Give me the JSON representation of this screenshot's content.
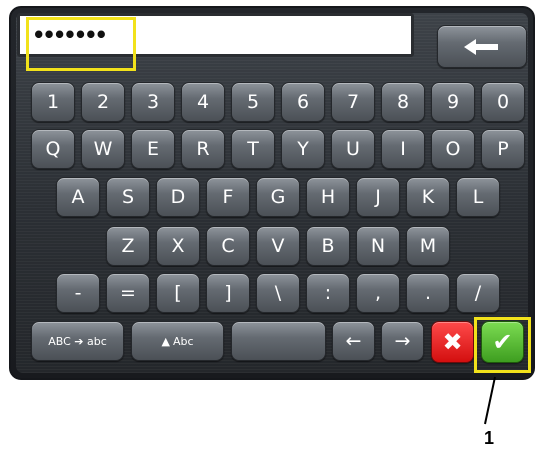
{
  "password_field": {
    "value": "•••••••"
  },
  "backspace": {
    "icon": "backspace-arrow-icon"
  },
  "rows": [
    [
      "1",
      "2",
      "3",
      "4",
      "5",
      "6",
      "7",
      "8",
      "9",
      "0"
    ],
    [
      "Q",
      "W",
      "E",
      "R",
      "T",
      "Y",
      "U",
      "I",
      "O",
      "P"
    ],
    [
      "A",
      "S",
      "D",
      "F",
      "G",
      "H",
      "J",
      "K",
      "L"
    ],
    [
      "Z",
      "X",
      "C",
      "V",
      "B",
      "N",
      "M"
    ],
    [
      "-",
      "=",
      "[",
      "]",
      "\\",
      ":",
      ",",
      ".",
      "/"
    ]
  ],
  "bottom_bar": {
    "case_toggle_label": "ABC ➔ abc",
    "shift_label": "Abc",
    "space_label": "",
    "cursor_left": "←",
    "cursor_right": "→",
    "cancel_symbol": "✖",
    "confirm_symbol": "✔"
  },
  "callout": {
    "label": "1"
  },
  "colors": {
    "highlight": "#f2e21b",
    "cancel": "#e21d1d",
    "confirm": "#5cbf34"
  }
}
